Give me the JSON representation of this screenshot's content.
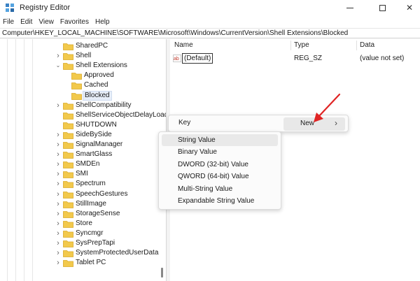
{
  "window": {
    "title": "Registry Editor"
  },
  "menubar": {
    "items": [
      "File",
      "Edit",
      "View",
      "Favorites",
      "Help"
    ]
  },
  "address": "Computer\\HKEY_LOCAL_MACHINE\\SOFTWARE\\Microsoft\\Windows\\CurrentVersion\\Shell Extensions\\Blocked",
  "tree": {
    "items": [
      {
        "label": "SharedPC",
        "level": 0,
        "expander": "none"
      },
      {
        "label": "Shell",
        "level": 0,
        "expander": "collapsed"
      },
      {
        "label": "Shell Extensions",
        "level": 0,
        "expander": "expanded"
      },
      {
        "label": "Approved",
        "level": 1,
        "expander": "none"
      },
      {
        "label": "Cached",
        "level": 1,
        "expander": "none"
      },
      {
        "label": "Blocked",
        "level": 1,
        "expander": "none",
        "selected": true
      },
      {
        "label": "ShellCompatibility",
        "level": 0,
        "expander": "collapsed"
      },
      {
        "label": "ShellServiceObjectDelayLoad",
        "level": 0,
        "expander": "none"
      },
      {
        "label": "SHUTDOWN",
        "level": 0,
        "expander": "none"
      },
      {
        "label": "SideBySide",
        "level": 0,
        "expander": "collapsed"
      },
      {
        "label": "SignalManager",
        "level": 0,
        "expander": "collapsed"
      },
      {
        "label": "SmartGlass",
        "level": 0,
        "expander": "collapsed"
      },
      {
        "label": "SMDEn",
        "level": 0,
        "expander": "collapsed"
      },
      {
        "label": "SMI",
        "level": 0,
        "expander": "collapsed"
      },
      {
        "label": "Spectrum",
        "level": 0,
        "expander": "collapsed"
      },
      {
        "label": "SpeechGestures",
        "level": 0,
        "expander": "collapsed"
      },
      {
        "label": "StillImage",
        "level": 0,
        "expander": "collapsed"
      },
      {
        "label": "StorageSense",
        "level": 0,
        "expander": "collapsed"
      },
      {
        "label": "Store",
        "level": 0,
        "expander": "collapsed"
      },
      {
        "label": "Syncmgr",
        "level": 0,
        "expander": "collapsed"
      },
      {
        "label": "SysPrepTapi",
        "level": 0,
        "expander": "collapsed"
      },
      {
        "label": "SystemProtectedUserData",
        "level": 0,
        "expander": "collapsed"
      },
      {
        "label": "Tablet PC",
        "level": 0,
        "expander": "collapsed"
      }
    ]
  },
  "list": {
    "columns": [
      "Name",
      "Type",
      "Data"
    ],
    "rows": [
      {
        "name": "(Default)",
        "type": "REG_SZ",
        "data": "(value not set)",
        "icon": "ab-string-icon"
      }
    ]
  },
  "context_menu": {
    "key_label": "Key",
    "new_label": "New"
  },
  "submenu": {
    "items": [
      "String Value",
      "Binary Value",
      "DWORD (32-bit) Value",
      "QWORD (64-bit) Value",
      "Multi-String Value",
      "Expandable String Value"
    ],
    "hovered_index": 0
  },
  "colors": {
    "folder": "#f2c94c",
    "folder_dark": "#d9a928",
    "annotation_arrow": "#e02424",
    "selection": "#e7eef8"
  }
}
